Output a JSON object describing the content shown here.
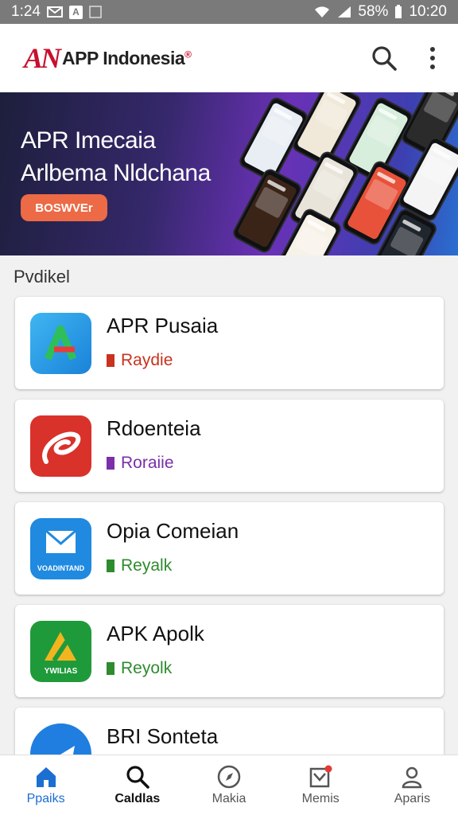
{
  "status_bar": {
    "time": "1:24",
    "indicator_a": "A",
    "battery": "58%",
    "clock": "10:20"
  },
  "header": {
    "logo_mark": "AN",
    "app_name": "APP Indonesia",
    "reg_mark": "®"
  },
  "banner": {
    "title_line1": "APR Imecaia",
    "title_line2": "Arlbema Nldchana",
    "button_label": "BOSWVEr"
  },
  "section": {
    "label": "Pvdikel"
  },
  "apps": [
    {
      "name": "APR Pusaia",
      "tag": "Raydie",
      "tag_color": "#c8321e",
      "icon_label": ""
    },
    {
      "name": "Rdoenteia",
      "tag": "Roraiie",
      "tag_color": "#7b2fa8",
      "icon_label": ""
    },
    {
      "name": "Opia Comeian",
      "tag": "Reyalk",
      "tag_color": "#2e8b2e",
      "icon_label": "VOADINTAND"
    },
    {
      "name": "APK Apolk",
      "tag": "Reyolk",
      "tag_color": "#2e8b2e",
      "icon_label": "YWILIAS"
    },
    {
      "name": "BRI Sonteta",
      "tag": "",
      "tag_color": "#2e8b2e",
      "icon_label": ""
    }
  ],
  "nav": [
    {
      "label": "Ppaiks",
      "icon": "home-icon"
    },
    {
      "label": "Caldlas",
      "icon": "search-icon"
    },
    {
      "label": "Makia",
      "icon": "compass-icon"
    },
    {
      "label": "Memis",
      "icon": "inbox-icon"
    },
    {
      "label": "Aparis",
      "icon": "profile-icon"
    }
  ],
  "colors": {
    "accent": "#1b6fd1",
    "brand": "#c8102e",
    "banner_button": "#ec6a45"
  }
}
